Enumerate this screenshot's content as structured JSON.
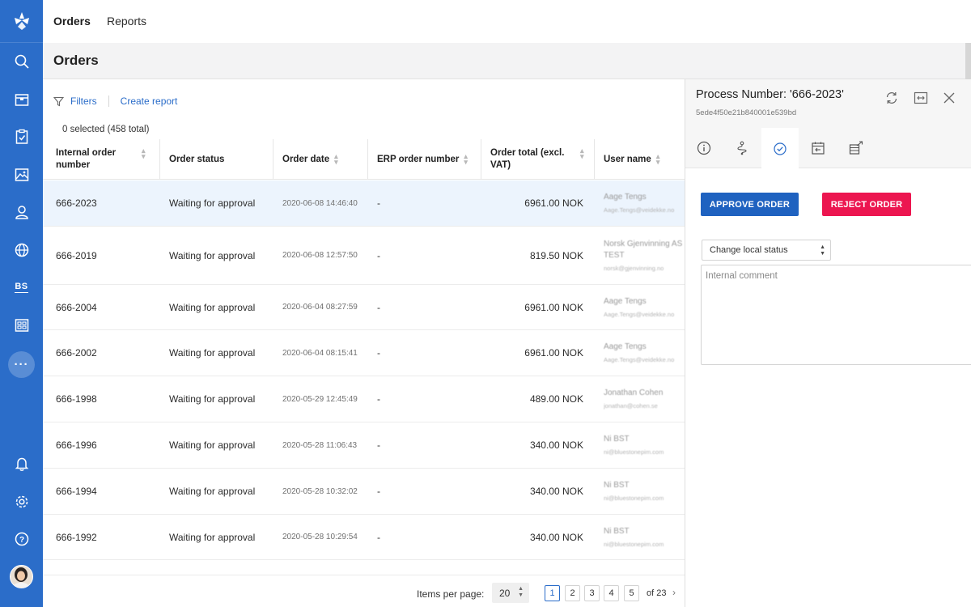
{
  "nav": {
    "tabs": [
      {
        "label": "Orders",
        "active": true
      },
      {
        "label": "Reports",
        "active": false
      }
    ]
  },
  "sidebar": {
    "items": [
      {
        "icon": "search-icon"
      },
      {
        "icon": "box-icon"
      },
      {
        "icon": "clipboard-check-icon"
      },
      {
        "icon": "image-icon"
      },
      {
        "icon": "user-icon"
      },
      {
        "icon": "globe-icon"
      },
      {
        "icon": "bs-icon",
        "label": "BS"
      },
      {
        "icon": "layout-icon"
      },
      {
        "icon": "more-icon",
        "label": "···"
      },
      {
        "icon": "bell-icon"
      },
      {
        "icon": "gear-icon"
      },
      {
        "icon": "help-icon",
        "label": "?"
      }
    ],
    "accent": "#2b6dc9"
  },
  "page": {
    "title": "Orders"
  },
  "toolbar": {
    "filters_label": "Filters",
    "create_report_label": "Create report",
    "selected_count": "0 selected (458 total)"
  },
  "table": {
    "columns": [
      "Internal order number",
      "Order status",
      "Order date",
      "ERP order number",
      "Order total (excl. VAT)",
      "User name"
    ],
    "rows": [
      {
        "order": "666-2023",
        "status": "Waiting for approval",
        "date": "2020-06-08 14:46:40",
        "erp": "-",
        "total": "6961.00 NOK",
        "user": "Aage Tengs",
        "user_sub": "Aage.Tengs@veidekke.no"
      },
      {
        "order": "666-2019",
        "status": "Waiting for approval",
        "date": "2020-06-08 12:57:50",
        "erp": "-",
        "total": "819.50 NOK",
        "user": "Norsk Gjenvinning AS",
        "user_2": "TEST",
        "user_sub": "norsk@gjenvinning.no"
      },
      {
        "order": "666-2004",
        "status": "Waiting for approval",
        "date": "2020-06-04 08:27:59",
        "erp": "-",
        "total": "6961.00 NOK",
        "user": "Aage Tengs",
        "user_sub": "Aage.Tengs@veidekke.no"
      },
      {
        "order": "666-2002",
        "status": "Waiting for approval",
        "date": "2020-06-04 08:15:41",
        "erp": "-",
        "total": "6961.00 NOK",
        "user": "Aage Tengs",
        "user_sub": "Aage.Tengs@veidekke.no"
      },
      {
        "order": "666-1998",
        "status": "Waiting for approval",
        "date": "2020-05-29 12:45:49",
        "erp": "-",
        "total": "489.00 NOK",
        "user": "Jonathan Cohen",
        "user_sub": "jonathan@cohen.se"
      },
      {
        "order": "666-1996",
        "status": "Waiting for approval",
        "date": "2020-05-28 11:06:43",
        "erp": "-",
        "total": "340.00 NOK",
        "user": "Ni BST",
        "user_sub": "ni@bluestonepim.com"
      },
      {
        "order": "666-1994",
        "status": "Waiting for approval",
        "date": "2020-05-28 10:32:02",
        "erp": "-",
        "total": "340.00 NOK",
        "user": "Ni BST",
        "user_sub": "ni@bluestonepim.com"
      },
      {
        "order": "666-1992",
        "status": "Waiting for approval",
        "date": "2020-05-28 10:29:54",
        "erp": "-",
        "total": "340.00 NOK",
        "user": "Ni BST",
        "user_sub": "ni@bluestonepim.com"
      }
    ]
  },
  "pagination": {
    "items_per_page_label": "Items per page:",
    "items_per_page": "20",
    "pages": [
      "1",
      "2",
      "3",
      "4",
      "5"
    ],
    "current_page": "1",
    "of_pages": "of 23",
    "next": "›"
  },
  "panel": {
    "title": "Process Number: '666-2023'",
    "subtitle": "5ede4f50e21b840001e539bd",
    "header_icons": [
      "refresh-icon",
      "expand-icon",
      "close-icon"
    ],
    "tabs": [
      {
        "icon": "info-icon"
      },
      {
        "icon": "route-icon"
      },
      {
        "icon": "check-circle-icon",
        "active": true
      },
      {
        "icon": "calendar-return-icon"
      },
      {
        "icon": "export-icon"
      }
    ],
    "approve_label": "APPROVE ORDER",
    "reject_label": "REJECT ORDER",
    "approve_color": "#1f62c0",
    "reject_color": "#ec1650",
    "local_status_value": "Change local status",
    "comment_placeholder": "Internal comment"
  }
}
